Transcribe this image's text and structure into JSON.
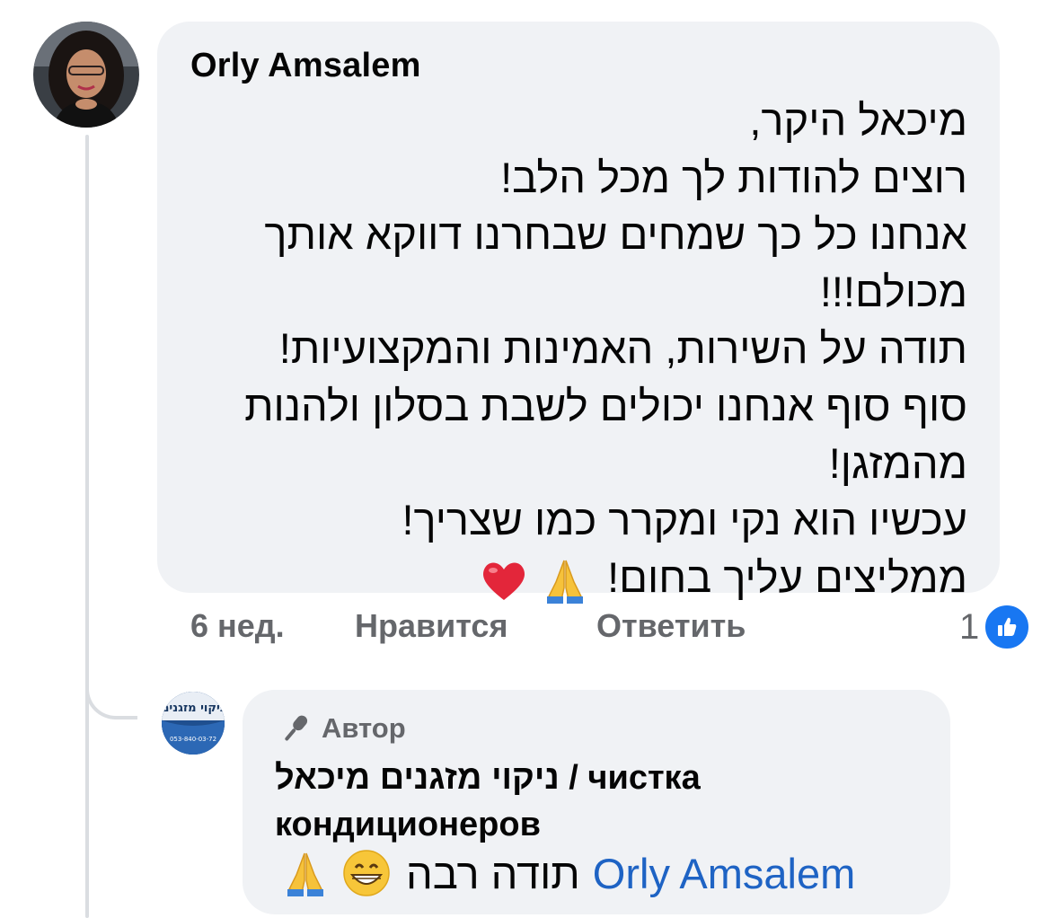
{
  "comment": {
    "author": "Orly Amsalem",
    "lines": [
      "מיכאל היקר,",
      "רוצים להודות לך מכל הלב!",
      "אנחנו כל כך שמחים שבחרנו דווקא אותך",
      "מכולם!!!",
      "תודה על השירות, האמינות והמקצועיות!",
      "סוף סוף אנחנו יכולים לשבת בסלון ולהנות",
      "מהמזגן!",
      "עכשיו הוא נקי ומקרר כמו שצריך!",
      "ממליצים עליך בחום!"
    ],
    "last_line_emojis": [
      "pray-emoji",
      "heart-emoji"
    ],
    "time": "6 нед.",
    "like_action": "Нравится",
    "reply_action": "Ответить",
    "reaction_count": "1",
    "reaction_type": "like-icon"
  },
  "reply": {
    "badge": "Автор",
    "badge_icon": "microphone-icon",
    "author_line1": "ניקוי מזגנים מיכאל / чистка",
    "author_line2": "кондиционеров",
    "mention": "Orly Amsalem",
    "text": "תודה רבה",
    "emojis": [
      "grin-emoji",
      "pray-emoji"
    ],
    "avatar_logo_text": "ניקוי מזגנים",
    "avatar_phone": "053-840-03-72"
  },
  "colors": {
    "bubble": "#f0f2f5",
    "secondary_text": "#65676b",
    "link": "#1e63c4",
    "like_blue": "#1877f2",
    "thread_line": "#dadde1"
  }
}
